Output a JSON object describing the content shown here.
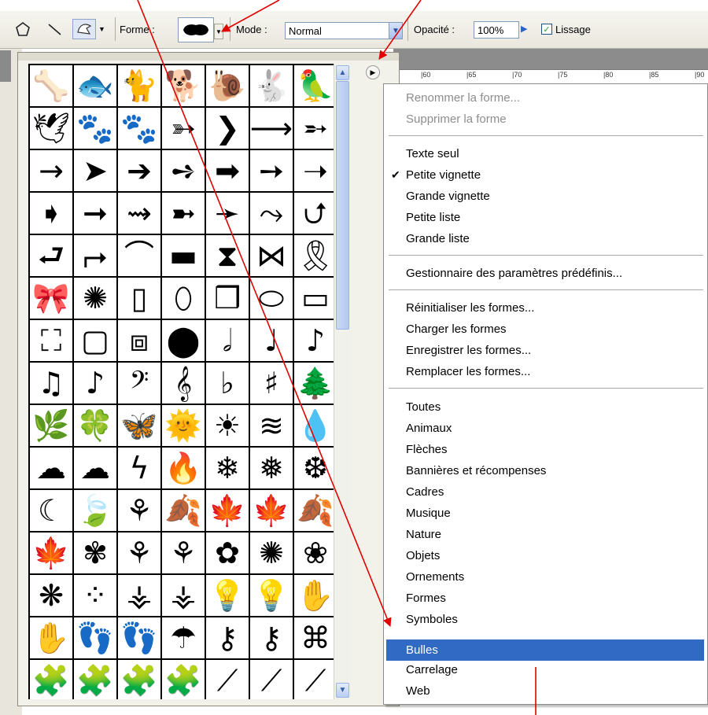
{
  "options": {
    "forme_label": "Forme :",
    "mode_label": "Mode :",
    "mode_value": "Normal",
    "opacite_label": "Opacité :",
    "opacite_value": "100%",
    "lissage_label": "Lissage",
    "lissage_checked": true
  },
  "ruler": {
    "ticks": [
      "|60",
      "|65",
      "|70",
      "|75",
      "|80",
      "|85",
      "|90"
    ]
  },
  "shapes_icons": [
    "bone-icon",
    "fish-icon",
    "cat-icon",
    "dog-icon",
    "snail-icon",
    "rabbit-icon",
    "bird-icon",
    "dove-icon",
    "paw-small-icon",
    "paw-large-icon",
    "arrow-feather-icon",
    "chevron-icon",
    "arrow-thin-icon",
    "arrow-feathered-icon",
    "arrow-line-icon",
    "arrowhead-icon",
    "arrow-bold-icon",
    "arrow-striped-icon",
    "arrow-block-icon",
    "arrow-long-icon",
    "arrow-tail-icon",
    "arrow-pentagon-icon",
    "arrow-heavy-icon",
    "arrow-wave-icon",
    "arrow-notched-icon",
    "arrow-hair-icon",
    "arrow-curly-icon",
    "arrow-uturn-icon",
    "arrow-curve-icon",
    "arrow-turn-icon",
    "banner-arc-icon",
    "banner-icon",
    "banner-wide-icon",
    "banner-bow-icon",
    "award-ribbon-icon",
    "ribbon-icon",
    "seal-icon",
    "frame-tall-icon",
    "frame-oval-icon",
    "frame-ornate-icon",
    "frame-ellipse-icon",
    "frame-classic-icon",
    "frame-wavy-icon",
    "frame-rough-icon",
    "frame-stamp-icon",
    "circle-thick-icon",
    "half-note-icon",
    "quarter-note-icon",
    "eighth-note-icon",
    "beamed-notes-icon",
    "eighth-note-2-icon",
    "bass-clef-icon",
    "treble-clef-icon",
    "flat-icon",
    "sharp-icon",
    "tree-icon",
    "fern-icon",
    "clover-icon",
    "butterfly-icon",
    "sun-swirl-icon",
    "sun-icon",
    "waves-icon",
    "raindrop-icon",
    "cloud-icon",
    "cloud-outline-icon",
    "lightning-icon",
    "fire-icon",
    "snowflake-1-icon",
    "snowflake-2-icon",
    "snowflake-3-icon",
    "moon-icon",
    "leaf-1-icon",
    "cannabis-leaf-icon",
    "leaf-2-icon",
    "leaf-3-icon",
    "maple-leaf-icon",
    "leaf-4-icon",
    "leaf-5-icon",
    "flower-1-icon",
    "branch-1-icon",
    "branch-2-icon",
    "flower-2-icon",
    "flower-3-icon",
    "flower-4-icon",
    "flower-5-icon",
    "dots-icon",
    "grass-icon",
    "grass-2-icon",
    "lightbulb-icon",
    "lightbulb-outline-icon",
    "hand-icon",
    "hand-2-icon",
    "footprint-left-icon",
    "footprint-right-icon",
    "umbrella-icon",
    "key-1-icon",
    "key-2-icon",
    "bow-icon",
    "puzzle-1-icon",
    "puzzle-2-icon",
    "puzzle-3-icon",
    "puzzle-4-icon",
    "pen-1-icon",
    "pen-2-icon",
    "pen-3-icon",
    "misc-1-icon",
    "misc-2-icon",
    "misc-3-icon",
    "misc-4-icon",
    "misc-5-icon",
    "misc-6-icon",
    "misc-7-icon"
  ],
  "shapes_glyphs": [
    "🦴",
    "🐟",
    "🐈",
    "🐕",
    "🐌",
    "🐇",
    "🦜",
    "🕊",
    "🐾",
    "🐾",
    "➳",
    "❯",
    "⟶",
    "➵",
    "→",
    "➤",
    "➔",
    "➺",
    "➡",
    "➙",
    "➝",
    "➧",
    "➞",
    "⇝",
    "➼",
    "➛",
    "⤳",
    "⮍",
    "⮐",
    "⮣",
    "⌒",
    "▬",
    "⧗",
    "⋈",
    "🎗",
    "🎀",
    "✺",
    "▯",
    "⬯",
    "❒",
    "⬭",
    "▭",
    "⛶",
    "▢",
    "⧈",
    "⬤",
    "𝅗𝅥",
    "♩",
    "♪",
    "♫",
    "♪",
    "𝄢",
    "𝄞",
    "♭",
    "♯",
    "🌲",
    "🌿",
    "🍀",
    "🦋",
    "🌞",
    "☀",
    "≋",
    "💧",
    "☁",
    "☁",
    "ϟ",
    "🔥",
    "❄",
    "❅",
    "❆",
    "☾",
    "🍃",
    "⚘",
    "🍂",
    "🍁",
    "🍁",
    "🍂",
    "🍁",
    "✾",
    "⚘",
    "⚘",
    "✿",
    "✺",
    "❀",
    "❋",
    "⁘",
    "⚶",
    "⚶",
    "💡",
    "💡",
    "✋",
    "✋",
    "👣",
    "👣",
    "☂",
    "⚷",
    "⚷",
    "⌘",
    "🧩",
    "🧩",
    "🧩",
    "🧩",
    "⟋",
    "⟋",
    "⟋",
    "⟋",
    "⟋",
    "⌒",
    "⌒",
    "⌒",
    "⌒",
    "⌒"
  ],
  "menu": {
    "items": [
      {
        "label": "Renommer la forme...",
        "disabled": true
      },
      {
        "label": "Supprimer la forme",
        "disabled": true
      },
      {
        "label": "Texte seul"
      },
      {
        "label": "Petite vignette",
        "checked": true
      },
      {
        "label": "Grande vignette"
      },
      {
        "label": "Petite liste"
      },
      {
        "label": "Grande liste"
      },
      {
        "label": "Gestionnaire des paramètres prédéfinis..."
      },
      {
        "label": "Réinitialiser les formes..."
      },
      {
        "label": "Charger les formes"
      },
      {
        "label": "Enregistrer les formes..."
      },
      {
        "label": "Remplacer les formes..."
      },
      {
        "label": "Toutes"
      },
      {
        "label": "Animaux"
      },
      {
        "label": "Flèches"
      },
      {
        "label": "Bannières et récompenses"
      },
      {
        "label": "Cadres"
      },
      {
        "label": "Musique"
      },
      {
        "label": "Nature"
      },
      {
        "label": "Objets"
      },
      {
        "label": "Ornements"
      },
      {
        "label": "Formes"
      },
      {
        "label": "Symboles"
      },
      {
        "label": "Bulles",
        "highlighted": true
      },
      {
        "label": "Carrelage"
      },
      {
        "label": "Web"
      }
    ]
  },
  "colors": {
    "highlight": "#316ac5",
    "annotation_arrow": "#e00000"
  }
}
